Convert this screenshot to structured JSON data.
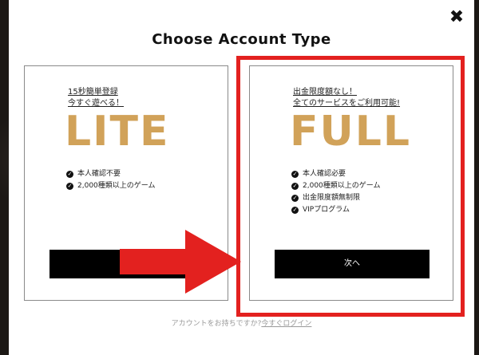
{
  "modal": {
    "title": "Choose Account Type",
    "close_symbol": "✖"
  },
  "lite": {
    "promo_lines": [
      "15秒簡単登録",
      "今すぐ遊べる！"
    ],
    "name": "LITE",
    "features": [
      "本人確認不要",
      "2,000種類以上のゲーム"
    ],
    "button_label": ""
  },
  "full": {
    "promo_lines": [
      "出金限度額なし！",
      "全てのサービスをご利用可能!"
    ],
    "name": "FULL",
    "features": [
      "本人確認必要",
      "2,000種類以上のゲーム",
      "出金限度額無制限",
      "VIPプログラム"
    ],
    "button_label": "次へ"
  },
  "footer": {
    "question": "アカウントをお持ちですか?",
    "login_link": "今すぐログイン"
  },
  "colors": {
    "accent_gold": "#d1a259",
    "highlight_red": "#e3211f",
    "button_black": "#000000"
  },
  "icons": {
    "feature_bullet": "check-circle-icon",
    "close": "close-icon",
    "annotation": "right-arrow-icon"
  }
}
